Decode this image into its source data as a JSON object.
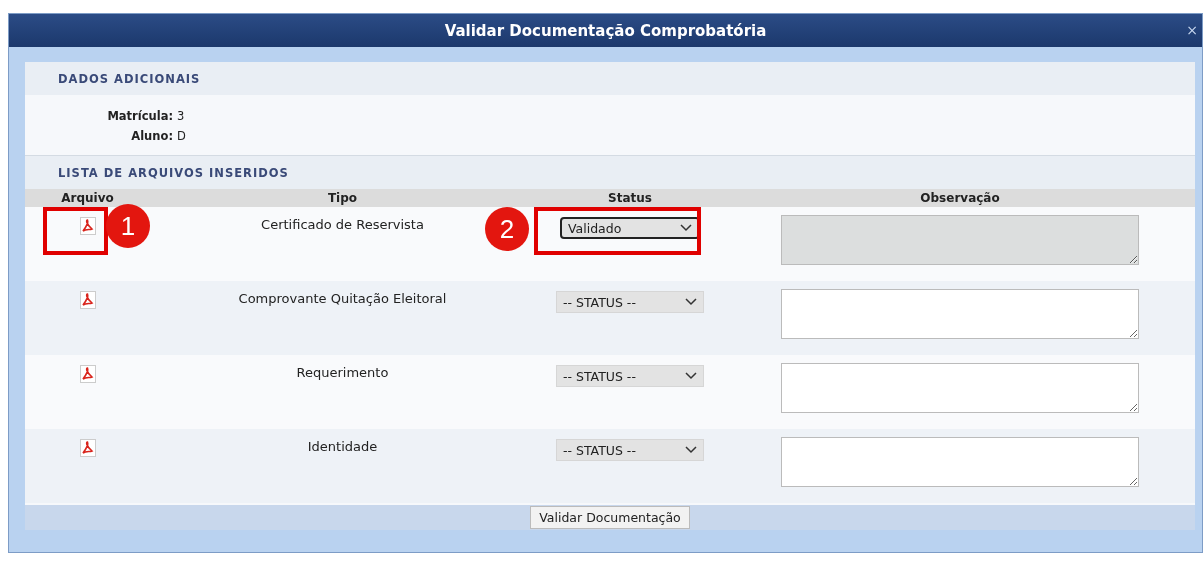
{
  "window": {
    "title": "Validar Documentação Comprobatória",
    "close": "×"
  },
  "additional_data": {
    "heading": "DADOS ADICIONAIS",
    "fields": [
      {
        "label": "Matrícula:",
        "value": "3"
      },
      {
        "label": "Aluno:",
        "value": "D"
      }
    ]
  },
  "files": {
    "heading": "LISTA DE ARQUIVOS INSERIDOS",
    "columns": [
      "Arquivo",
      "Tipo",
      "Status",
      "Observação"
    ],
    "rows": [
      {
        "type": "Certificado de Reservista",
        "status": "Validado",
        "status_set": true,
        "observation_disabled": true
      },
      {
        "type": "Comprovante Quitação Eleitoral",
        "status": "-- STATUS --",
        "status_set": false,
        "observation_disabled": false
      },
      {
        "type": "Requerimento",
        "status": "-- STATUS --",
        "status_set": false,
        "observation_disabled": false
      },
      {
        "type": "Identidade",
        "status": "-- STATUS --",
        "status_set": false,
        "observation_disabled": false
      }
    ]
  },
  "annotations": [
    {
      "number": "1",
      "kind": "file"
    },
    {
      "number": "2",
      "kind": "status"
    }
  ],
  "submit_button": "Validar Documentação"
}
